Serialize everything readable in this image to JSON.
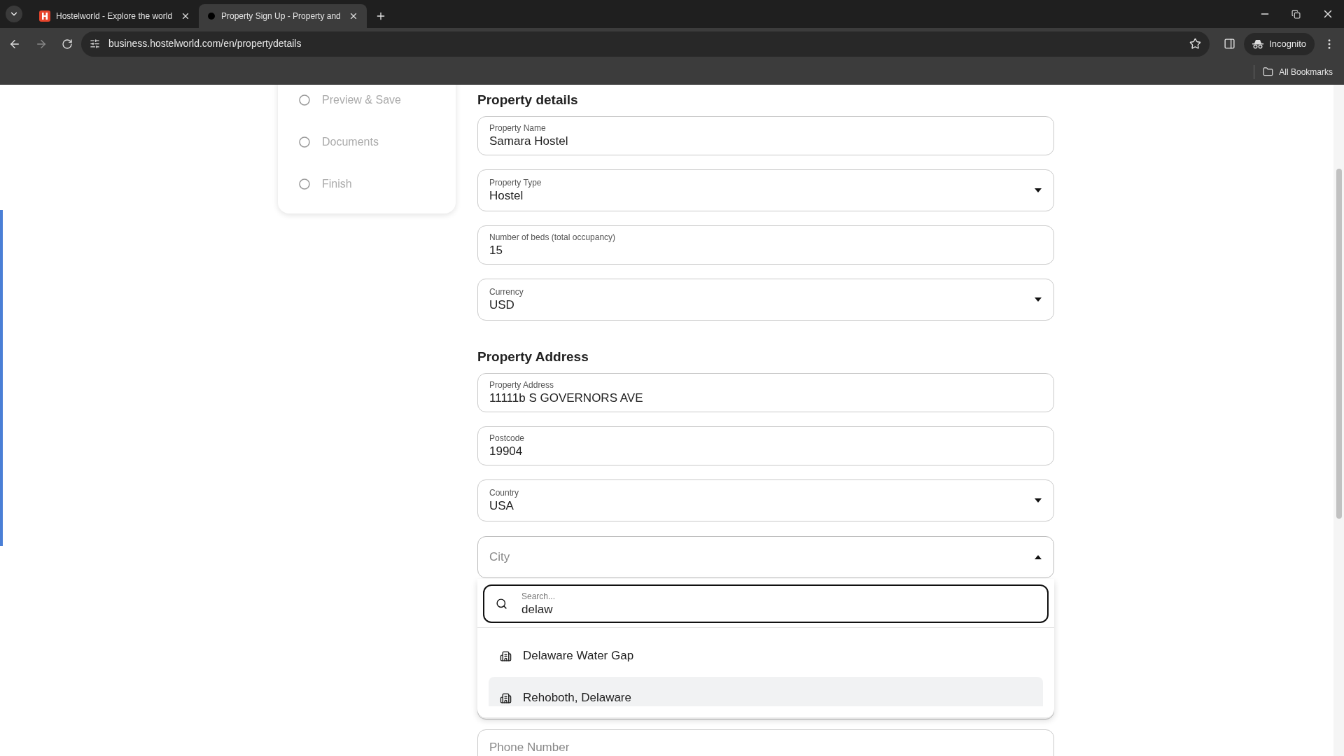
{
  "browser": {
    "tabs": [
      {
        "title": "Hostelworld - Explore the world",
        "selected": false,
        "kind": "logo"
      },
      {
        "title": "Property Sign Up - Property and",
        "selected": true,
        "kind": "dot"
      }
    ],
    "url": "business.hostelworld.com/en/propertydetails",
    "profile": "Incognito",
    "bookmarks": "All Bookmarks"
  },
  "steps": [
    {
      "label": "Preview & Save"
    },
    {
      "label": "Documents"
    },
    {
      "label": "Finish"
    }
  ],
  "sections": [
    {
      "title": "Property details",
      "fields": [
        {
          "label": "Property Name",
          "value": "Samara Hostel",
          "kind": "text"
        },
        {
          "label": "Property Type",
          "value": "Hostel",
          "kind": "select"
        },
        {
          "label": "Number of beds (total occupancy)",
          "value": "15",
          "kind": "text"
        },
        {
          "label": "Currency",
          "value": "USD",
          "kind": "select"
        }
      ]
    },
    {
      "title": "Property Address",
      "fields": [
        {
          "label": "Property Address",
          "value": "11111b S GOVERNORS AVE",
          "kind": "text"
        },
        {
          "label": "Postcode",
          "value": "19904",
          "kind": "text"
        },
        {
          "label": "Country",
          "value": "USA",
          "kind": "select"
        }
      ]
    }
  ],
  "city": {
    "placeholder": "City",
    "expanded": true,
    "search": {
      "placeholder": "Search...",
      "value": "delaw"
    },
    "options": [
      {
        "label": "Delaware Water Gap",
        "selected": false
      },
      {
        "label": "Rehoboth, Delaware",
        "selected": true
      }
    ]
  },
  "phone": {
    "placeholder": "Phone Number"
  }
}
